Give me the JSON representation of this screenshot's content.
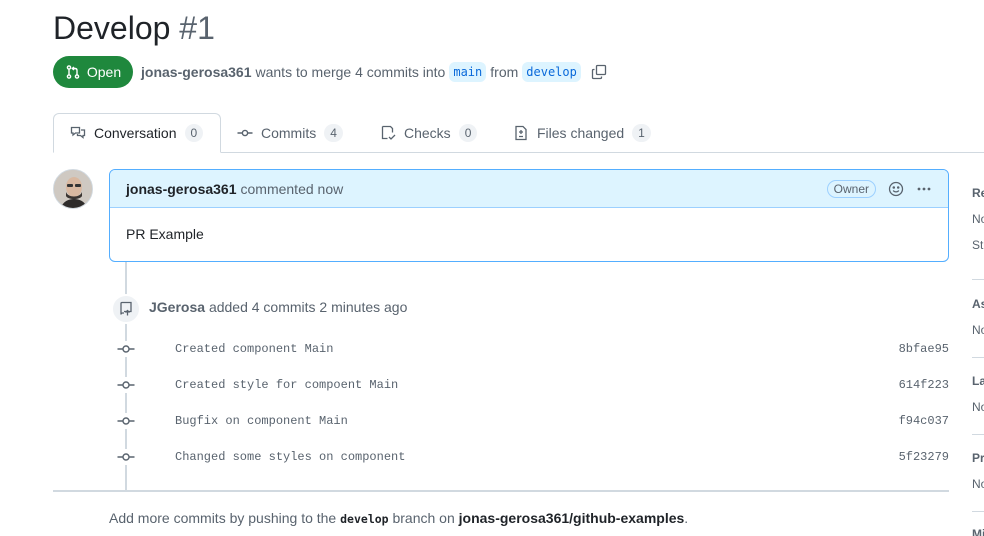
{
  "pr": {
    "title": "Develop",
    "number": "#1",
    "state": "Open",
    "author": "jonas-gerosa361",
    "merge_text": "wants to merge 4 commits into",
    "base_branch": "main",
    "from_text": "from",
    "head_branch": "develop"
  },
  "tabs": [
    {
      "label": "Conversation",
      "count": "0",
      "icon": "comment-discussion-icon"
    },
    {
      "label": "Commits",
      "count": "4",
      "icon": "git-commit-icon"
    },
    {
      "label": "Checks",
      "count": "0",
      "icon": "checklist-icon"
    },
    {
      "label": "Files changed",
      "count": "1",
      "icon": "file-diff-icon"
    }
  ],
  "comment": {
    "author": "jonas-gerosa361",
    "action": "commented now",
    "badge": "Owner",
    "body": "PR Example"
  },
  "commit_group": {
    "author": "JGerosa",
    "text": "added 4 commits 2 minutes ago"
  },
  "commits": [
    {
      "message": "Created component Main",
      "sha": "8bfae95"
    },
    {
      "message": "Created style for compoent Main",
      "sha": "614f223"
    },
    {
      "message": "Bugfix on component Main",
      "sha": "f94c037"
    },
    {
      "message": "Changed some styles on component",
      "sha": "5f23279"
    }
  ],
  "push_hint": {
    "before": "Add more commits by pushing to the",
    "branch": "develop",
    "middle": "branch on",
    "repo": "jonas-gerosa361/github-examples",
    "after": "."
  },
  "sidebar": {
    "sections": [
      {
        "title": "Re",
        "value": "No",
        "value2": "St"
      },
      {
        "title": "As",
        "value": "No"
      },
      {
        "title": "La",
        "value": "No"
      },
      {
        "title": "Pr",
        "value": "No"
      },
      {
        "title": "Mi"
      }
    ]
  },
  "colors": {
    "open_green": "#1f883d",
    "accent_blue": "#0969da",
    "comment_header_bg": "#ddf4ff",
    "comment_border": "#54aeff"
  }
}
